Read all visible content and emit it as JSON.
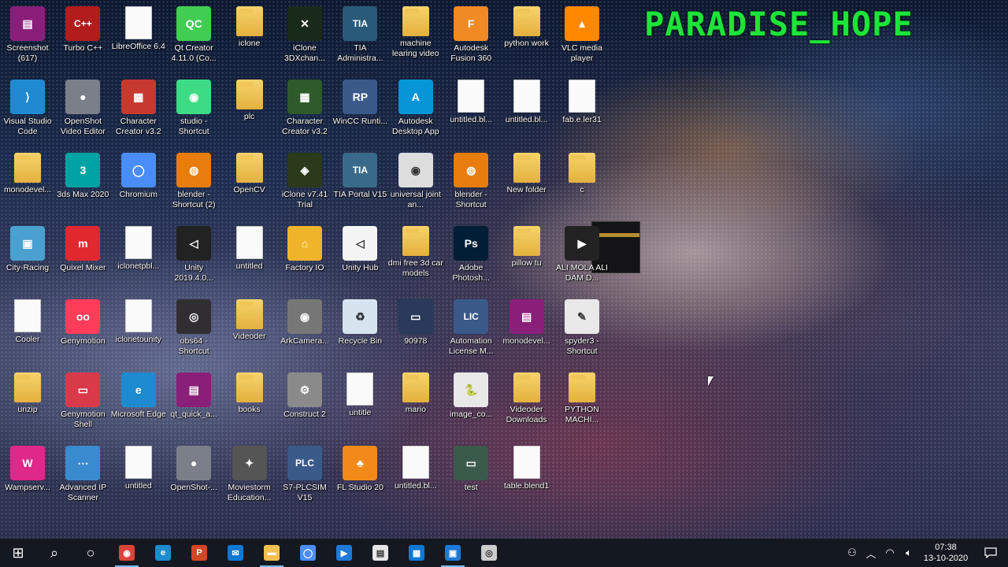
{
  "watermark": "PARADISE_HOPE",
  "desktop": {
    "icons": [
      {
        "label": "Screenshot (617)",
        "icon": "winrar-icon",
        "color": "#8a1f7a",
        "glyph": "▤",
        "col": 0,
        "row": 0
      },
      {
        "label": "Turbo C++",
        "icon": "turbo-cpp-icon",
        "color": "#b21c1c",
        "glyph": "C++",
        "col": 1,
        "row": 0
      },
      {
        "label": "LibreOffice 6.4",
        "icon": "libreoffice-icon",
        "color": "#ffffff",
        "glyph": "",
        "col": 2,
        "row": 0,
        "type": "doc"
      },
      {
        "label": "Qt Creator 4.11.0 (Co...",
        "icon": "qt-creator-icon",
        "color": "#41cd52",
        "glyph": "QC",
        "col": 3,
        "row": 0
      },
      {
        "label": "iclone",
        "icon": "folder-icon",
        "col": 4,
        "row": 0,
        "type": "folder"
      },
      {
        "label": "iClone 3DXchan...",
        "icon": "iclone-3dxchange-icon",
        "color": "#1a2a1a",
        "glyph": "✕",
        "col": 5,
        "row": 0
      },
      {
        "label": "TIA Administra...",
        "icon": "tia-admin-icon",
        "color": "#2a5a7a",
        "glyph": "TIA",
        "col": 6,
        "row": 0
      },
      {
        "label": "machine learing video",
        "icon": "folder-icon",
        "col": 7,
        "row": 0,
        "type": "folder"
      },
      {
        "label": "Autodesk Fusion 360",
        "icon": "fusion360-icon",
        "color": "#f08a24",
        "glyph": "F",
        "col": 8,
        "row": 0
      },
      {
        "label": "python work",
        "icon": "folder-icon",
        "col": 9,
        "row": 0,
        "type": "folder"
      },
      {
        "label": "VLC media player",
        "icon": "vlc-icon",
        "color": "#ff8800",
        "glyph": "▲",
        "col": 10,
        "row": 0
      },
      {
        "label": "Visual Studio Code",
        "icon": "vscode-icon",
        "color": "#1f8ad2",
        "glyph": "⟩",
        "col": 0,
        "row": 1
      },
      {
        "label": "OpenShot Video Editor",
        "icon": "openshot-icon",
        "color": "#7a7f8a",
        "glyph": "●",
        "col": 1,
        "row": 1
      },
      {
        "label": "Character Creator v3.2",
        "icon": "character-creator-icon",
        "color": "#c7392f",
        "glyph": "▦",
        "col": 2,
        "row": 1
      },
      {
        "label": "studio - Shortcut",
        "icon": "android-studio-icon",
        "color": "#3ddc84",
        "glyph": "◉",
        "col": 3,
        "row": 1
      },
      {
        "label": "plc",
        "icon": "folder-icon",
        "col": 4,
        "row": 1,
        "type": "folder"
      },
      {
        "label": "Character Creator v3.2",
        "icon": "character-creator-green-icon",
        "color": "#2f5a2a",
        "glyph": "▦",
        "col": 5,
        "row": 1
      },
      {
        "label": "WinCC Runti...",
        "icon": "wincc-icon",
        "color": "#3a5a8a",
        "glyph": "RP",
        "col": 6,
        "row": 1
      },
      {
        "label": "Autodesk Desktop App",
        "icon": "autodesk-app-icon",
        "color": "#0696d7",
        "glyph": "A",
        "col": 7,
        "row": 1
      },
      {
        "label": "untitled.bl...",
        "icon": "blend-file-icon",
        "col": 8,
        "row": 1,
        "type": "doc"
      },
      {
        "label": "untitled.bl...",
        "icon": "blend-file-icon",
        "col": 9,
        "row": 1,
        "type": "doc"
      },
      {
        "label": "fab.e.ler31",
        "icon": "file-icon",
        "col": 10,
        "row": 1,
        "type": "doc"
      },
      {
        "label": "monodevel...",
        "icon": "folder-icon",
        "col": 0,
        "row": 2,
        "type": "folder"
      },
      {
        "label": "3ds Max 2020",
        "icon": "3ds-max-icon",
        "color": "#00a3a3",
        "glyph": "3",
        "col": 1,
        "row": 2
      },
      {
        "label": "Chromium",
        "icon": "chromium-icon",
        "color": "#4b8df8",
        "glyph": "◯",
        "col": 2,
        "row": 2
      },
      {
        "label": "blender - Shortcut (2)",
        "icon": "blender-icon",
        "color": "#e87d0d",
        "glyph": "◍",
        "col": 3,
        "row": 2
      },
      {
        "label": "OpenCV",
        "icon": "folder-icon",
        "col": 4,
        "row": 2,
        "type": "folder"
      },
      {
        "label": "iClone v7.41 Trial",
        "icon": "iclone-icon",
        "color": "#2a3a1a",
        "glyph": "◈",
        "col": 5,
        "row": 2
      },
      {
        "label": "TIA Portal V15",
        "icon": "tia-portal-icon",
        "color": "#3a6a8a",
        "glyph": "TIA",
        "col": 6,
        "row": 2
      },
      {
        "label": "universal joint an...",
        "icon": "video-file-icon",
        "color": "#ddd",
        "glyph": "◉",
        "col": 7,
        "row": 2
      },
      {
        "label": "blender - Shortcut",
        "icon": "blender-icon",
        "color": "#e87d0d",
        "glyph": "◍",
        "col": 8,
        "row": 2
      },
      {
        "label": "New folder",
        "icon": "folder-icon",
        "col": 9,
        "row": 2,
        "type": "folder"
      },
      {
        "label": "c",
        "icon": "folder-icon",
        "col": 10,
        "row": 2,
        "type": "folder"
      },
      {
        "label": "City-Racing",
        "icon": "city-racing-icon",
        "color": "#4aa0d0",
        "glyph": "▣",
        "col": 0,
        "row": 3
      },
      {
        "label": "Quixel Mixer",
        "icon": "quixel-mixer-icon",
        "color": "#e0282f",
        "glyph": "m",
        "col": 1,
        "row": 3
      },
      {
        "label": "iclonetpbl...",
        "icon": "unity-file-icon",
        "col": 2,
        "row": 3,
        "type": "doc"
      },
      {
        "label": "Unity 2019.4.0...",
        "icon": "unity-icon",
        "color": "#222",
        "glyph": "◁",
        "col": 3,
        "row": 3
      },
      {
        "label": "untitled",
        "icon": "unity-file-icon",
        "col": 4,
        "row": 3,
        "type": "doc"
      },
      {
        "label": "Factory IO",
        "icon": "factory-io-icon",
        "color": "#f0b42a",
        "glyph": "⌂",
        "col": 5,
        "row": 3
      },
      {
        "label": "Unity Hub",
        "icon": "unity-hub-icon",
        "color": "#f4f4f4",
        "glyph": "◁",
        "col": 6,
        "row": 3
      },
      {
        "label": "dmi free 3d car models",
        "icon": "folder-icon",
        "col": 7,
        "row": 3,
        "type": "folder"
      },
      {
        "label": "Adobe Photosh...",
        "icon": "photoshop-icon",
        "color": "#001e36",
        "glyph": "Ps",
        "col": 8,
        "row": 3
      },
      {
        "label": "pillow tu",
        "icon": "folder-icon",
        "col": 9,
        "row": 3,
        "type": "folder"
      },
      {
        "label": "ALI MOLA ALI DAM D...",
        "icon": "video-thumb-icon",
        "color": "#222",
        "glyph": "▶",
        "col": 10,
        "row": 3
      },
      {
        "label": "Cooler",
        "icon": "file-icon",
        "col": 0,
        "row": 4,
        "type": "doc"
      },
      {
        "label": "Genymotion",
        "icon": "genymotion-icon",
        "color": "#ff3c5a",
        "glyph": "oo",
        "col": 1,
        "row": 4
      },
      {
        "label": "iclonetounity",
        "icon": "unity-file-icon",
        "col": 2,
        "row": 4,
        "type": "doc"
      },
      {
        "label": "obs64 - Shortcut",
        "icon": "obs-icon",
        "color": "#302e31",
        "glyph": "◎",
        "col": 3,
        "row": 4
      },
      {
        "label": "Videoder",
        "icon": "folder-icon",
        "col": 4,
        "row": 4,
        "type": "folder"
      },
      {
        "label": "ArkCamera...",
        "icon": "ark-camera-icon",
        "color": "#777",
        "glyph": "◉",
        "col": 5,
        "row": 4
      },
      {
        "label": "Recycle Bin",
        "icon": "recycle-bin-icon",
        "color": "#d6e4f0",
        "glyph": "♻",
        "col": 6,
        "row": 4
      },
      {
        "label": "90978",
        "icon": "image-thumb-icon",
        "color": "#2a3a5a",
        "glyph": "▭",
        "col": 7,
        "row": 4
      },
      {
        "label": "Automation License M...",
        "icon": "automation-license-icon",
        "color": "#3a5a8a",
        "glyph": "LIC",
        "col": 8,
        "row": 4
      },
      {
        "label": "monodevel...",
        "icon": "winrar-icon",
        "color": "#8a1f7a",
        "glyph": "▤",
        "col": 9,
        "row": 4
      },
      {
        "label": "spyder3 - Shortcut",
        "icon": "spyder-icon",
        "color": "#e8e8e8",
        "glyph": "✎",
        "col": 10,
        "row": 4
      },
      {
        "label": "unzip",
        "icon": "folder-icon",
        "col": 0,
        "row": 5,
        "type": "folder"
      },
      {
        "label": "Genymotion Shell",
        "icon": "genymotion-shell-icon",
        "color": "#d93a4a",
        "glyph": "▭",
        "col": 1,
        "row": 5
      },
      {
        "label": "Microsoft Edge",
        "icon": "edge-icon",
        "color": "#1e8bd0",
        "glyph": "e",
        "col": 2,
        "row": 5
      },
      {
        "label": "qt_quick_a...",
        "icon": "winrar-icon",
        "color": "#8a1f7a",
        "glyph": "▤",
        "col": 3,
        "row": 5
      },
      {
        "label": "books",
        "icon": "folder-icon",
        "col": 4,
        "row": 5,
        "type": "folder"
      },
      {
        "label": "Construct 2",
        "icon": "construct2-icon",
        "color": "#8a8a8a",
        "glyph": "⚙",
        "col": 5,
        "row": 5
      },
      {
        "label": "untitle",
        "icon": "unity-file-icon",
        "col": 6,
        "row": 5,
        "type": "doc"
      },
      {
        "label": "mario",
        "icon": "folder-icon",
        "col": 7,
        "row": 5,
        "type": "folder"
      },
      {
        "label": "image_co...",
        "icon": "python-file-icon",
        "color": "#e8e8e8",
        "glyph": "🐍",
        "col": 8,
        "row": 5
      },
      {
        "label": "Videoder Downloads",
        "icon": "folder-icon",
        "col": 9,
        "row": 5,
        "type": "folder"
      },
      {
        "label": "PYTHON MACHI...",
        "icon": "folder-icon",
        "col": 10,
        "row": 5,
        "type": "folder"
      },
      {
        "label": "Wampserv...",
        "icon": "wampserver-icon",
        "color": "#e0278a",
        "glyph": "W",
        "col": 0,
        "row": 6
      },
      {
        "label": "Advanced IP Scanner",
        "icon": "advanced-ip-scanner-icon",
        "color": "#3a8ad0",
        "glyph": "⋯",
        "col": 1,
        "row": 6
      },
      {
        "label": "untitled",
        "icon": "file-icon",
        "col": 2,
        "row": 6,
        "type": "doc"
      },
      {
        "label": "OpenShot-...",
        "icon": "openshot-icon",
        "color": "#7a7f8a",
        "glyph": "●",
        "col": 3,
        "row": 6
      },
      {
        "label": "Moviestorm Education...",
        "icon": "moviestorm-icon",
        "color": "#555",
        "glyph": "✦",
        "col": 4,
        "row": 6
      },
      {
        "label": "S7-PLCSIM V15",
        "icon": "plcsim-icon",
        "color": "#3a5a8a",
        "glyph": "PLC",
        "col": 5,
        "row": 6
      },
      {
        "label": "FL Studio 20",
        "icon": "fl-studio-icon",
        "color": "#f28a1a",
        "glyph": "♣",
        "col": 6,
        "row": 6
      },
      {
        "label": "untitled.bl...",
        "icon": "blend-file-icon",
        "col": 7,
        "row": 6,
        "type": "doc"
      },
      {
        "label": "test",
        "icon": "image-thumb-icon",
        "color": "#3a5a4a",
        "glyph": "▭",
        "col": 8,
        "row": 6
      },
      {
        "label": "table.blend1",
        "icon": "blend-file-icon",
        "col": 9,
        "row": 6,
        "type": "doc"
      }
    ]
  },
  "taskbar": {
    "apps": [
      {
        "name": "start-button",
        "icon": "windows-logo-icon",
        "glyph": "⊞",
        "color": "#ffffff"
      },
      {
        "name": "search-button",
        "icon": "search-icon",
        "glyph": "⌕",
        "color": "#ffffff"
      },
      {
        "name": "cortana-button",
        "icon": "cortana-icon",
        "glyph": "○",
        "color": "#ffffff"
      },
      {
        "name": "taskbar-chrome",
        "icon": "chrome-icon",
        "glyph": "◉",
        "color": "#db4437",
        "running": true
      },
      {
        "name": "taskbar-edge",
        "icon": "edge-icon",
        "glyph": "e",
        "color": "#1e8bd0"
      },
      {
        "name": "taskbar-wps",
        "icon": "wps-presentation-icon",
        "glyph": "P",
        "color": "#d24726"
      },
      {
        "name": "taskbar-mail",
        "icon": "mail-icon",
        "glyph": "✉",
        "color": "#0f78d4"
      },
      {
        "name": "taskbar-file-explorer",
        "icon": "folder-icon",
        "glyph": "▬",
        "color": "#f2c14e",
        "running": true
      },
      {
        "name": "taskbar-chromium",
        "icon": "chromium-icon",
        "glyph": "◯",
        "color": "#4b8df8"
      },
      {
        "name": "taskbar-video-editor",
        "icon": "video-editor-icon",
        "glyph": "▶",
        "color": "#1e7ad6"
      },
      {
        "name": "taskbar-document",
        "icon": "document-icon",
        "glyph": "▤",
        "color": "#e6e6e6"
      },
      {
        "name": "taskbar-store",
        "icon": "store-icon",
        "glyph": "▦",
        "color": "#0f78d4"
      },
      {
        "name": "taskbar-screen-recorder",
        "icon": "screen-recorder-icon",
        "glyph": "▣",
        "color": "#1e7ad6",
        "running": true
      },
      {
        "name": "taskbar-obs",
        "icon": "obs-icon",
        "glyph": "◎",
        "color": "#cccccc"
      }
    ],
    "tray": {
      "people_icon": "person-icon",
      "chevron_icon": "chevron-up-icon",
      "network_icon": "wifi-icon",
      "volume_icon": "volume-icon",
      "time": "07:38",
      "date": "13-10-2020",
      "notification_icon": "notification-icon"
    }
  }
}
